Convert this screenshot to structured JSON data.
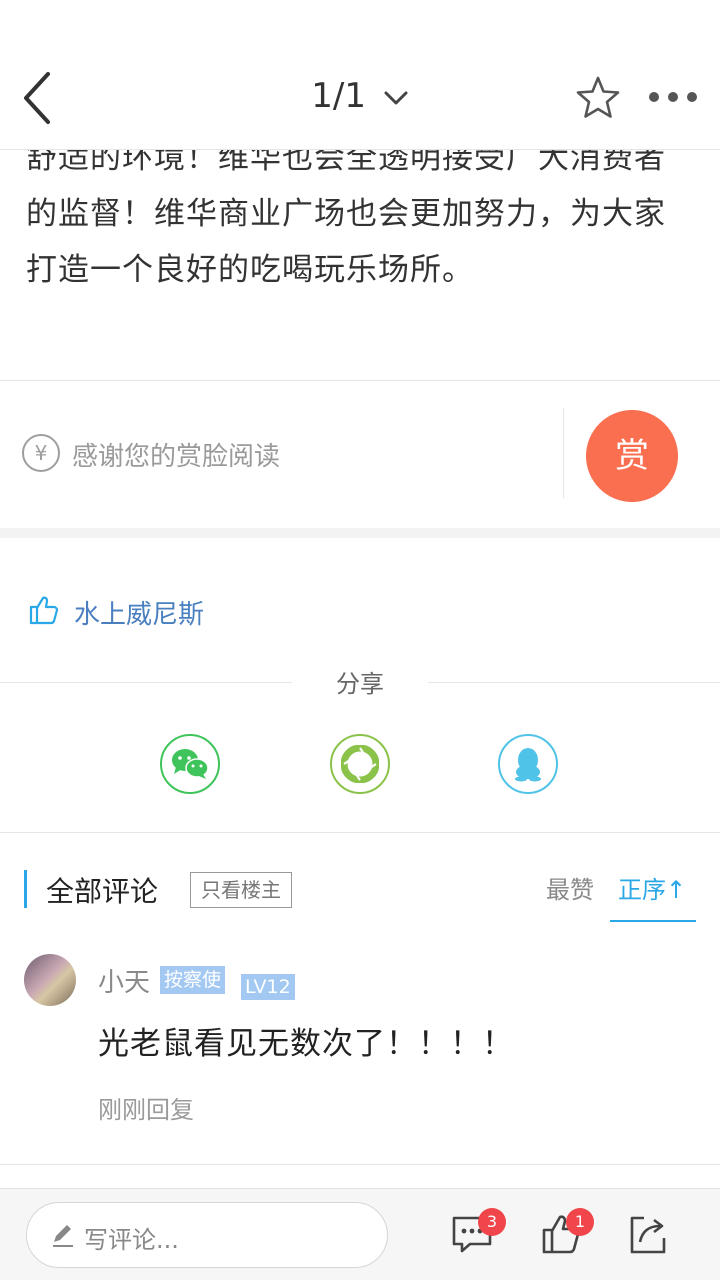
{
  "header": {
    "page_indicator": "1/1"
  },
  "article": {
    "lines": [
      "舒适的环境！维华也会全透明接受广大消费者",
      "的监督！维华商业广场也会更加努力，为大家",
      "打造一个良好的吃喝玩乐场所。"
    ]
  },
  "reward": {
    "currency_symbol": "¥",
    "prompt": "感谢您的赏脸阅读",
    "button_label": "赏"
  },
  "likes": {
    "users": "水上威尼斯"
  },
  "share": {
    "label": "分享",
    "targets": [
      "wechat-icon",
      "moments-icon",
      "qq-icon"
    ]
  },
  "comments": {
    "title": "全部评论",
    "only_op_label": "只看楼主",
    "sort_hot": "最赞",
    "sort_order": "正序↑",
    "items": [
      {
        "user": "小天",
        "role_badge": "按察使",
        "level": "LV12",
        "text": "光老鼠看见无数次了！！！！",
        "time": "刚刚回复"
      }
    ]
  },
  "bottom_bar": {
    "input_placeholder": "写评论...",
    "comment_count": "3",
    "like_count": "1"
  },
  "colors": {
    "accent": "#2aa7e6",
    "reward": "#fb6f51",
    "badge": "#a3c9f2",
    "count_badge": "#f0454a"
  }
}
